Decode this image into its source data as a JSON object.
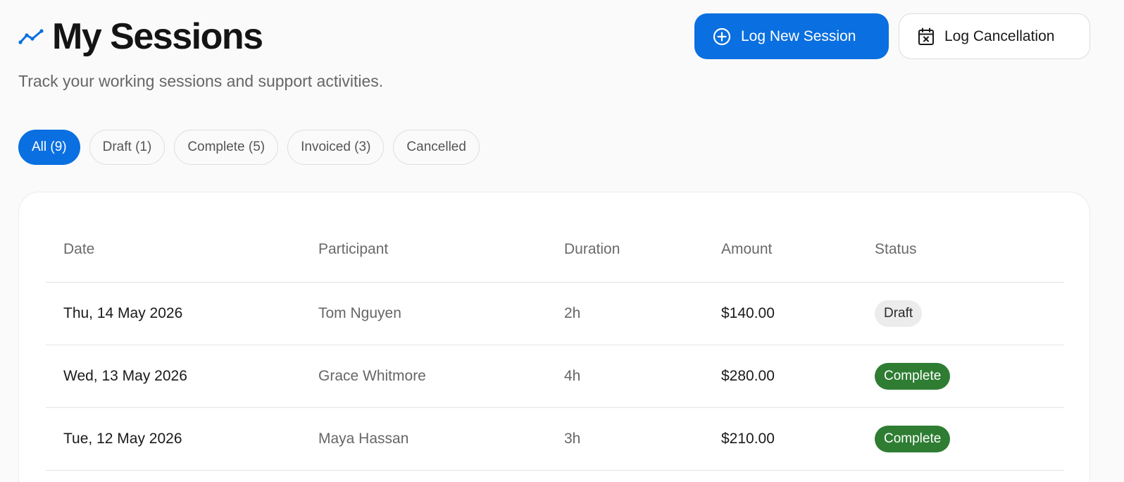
{
  "header": {
    "title": "My Sessions",
    "subtitle": "Track your working sessions and support activities.",
    "icon": "trend-line-icon"
  },
  "actions": {
    "log_session_label": "Log New Session",
    "log_cancellation_label": "Log Cancellation"
  },
  "filters": [
    {
      "label": "All (9)",
      "active": true
    },
    {
      "label": "Draft (1)",
      "active": false
    },
    {
      "label": "Complete (5)",
      "active": false
    },
    {
      "label": "Invoiced (3)",
      "active": false
    },
    {
      "label": "Cancelled",
      "active": false
    }
  ],
  "table": {
    "columns": [
      "Date",
      "Participant",
      "Duration",
      "Amount",
      "Status"
    ],
    "rows": [
      {
        "date": "Thu, 14 May 2026",
        "participant": "Tom Nguyen",
        "duration": "2h",
        "amount": "$140.00",
        "status": "Draft"
      },
      {
        "date": "Wed, 13 May 2026",
        "participant": "Grace Whitmore",
        "duration": "4h",
        "amount": "$280.00",
        "status": "Complete"
      },
      {
        "date": "Tue, 12 May 2026",
        "participant": "Maya Hassan",
        "duration": "3h",
        "amount": "$210.00",
        "status": "Complete"
      }
    ]
  },
  "colors": {
    "primary": "#0a6fe0",
    "complete": "#2e7d32",
    "draft": "#ececec"
  }
}
